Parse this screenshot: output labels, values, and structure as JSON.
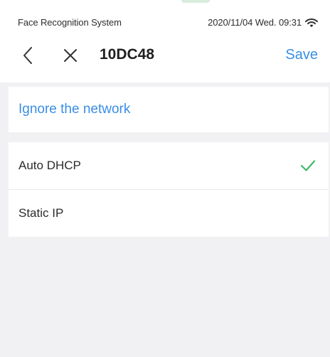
{
  "status_bar": {
    "app_name": "Face Recognition System",
    "datetime": "2020/11/04  Wed.  09:31",
    "wifi_icon": "wifi-icon"
  },
  "nav": {
    "back_icon": "chevron-left-icon",
    "close_icon": "close-icon",
    "title": "10DC48",
    "save_label": "Save"
  },
  "network": {
    "ignore_label": "Ignore the network"
  },
  "ip_options": {
    "items": [
      {
        "label": "Auto DHCP",
        "selected": true
      },
      {
        "label": "Static IP",
        "selected": false
      }
    ],
    "check_icon": "checkmark-icon"
  },
  "colors": {
    "accent_blue": "#3a8ee6",
    "check_green": "#3fb86a",
    "background_gray": "#f1f1f3"
  }
}
